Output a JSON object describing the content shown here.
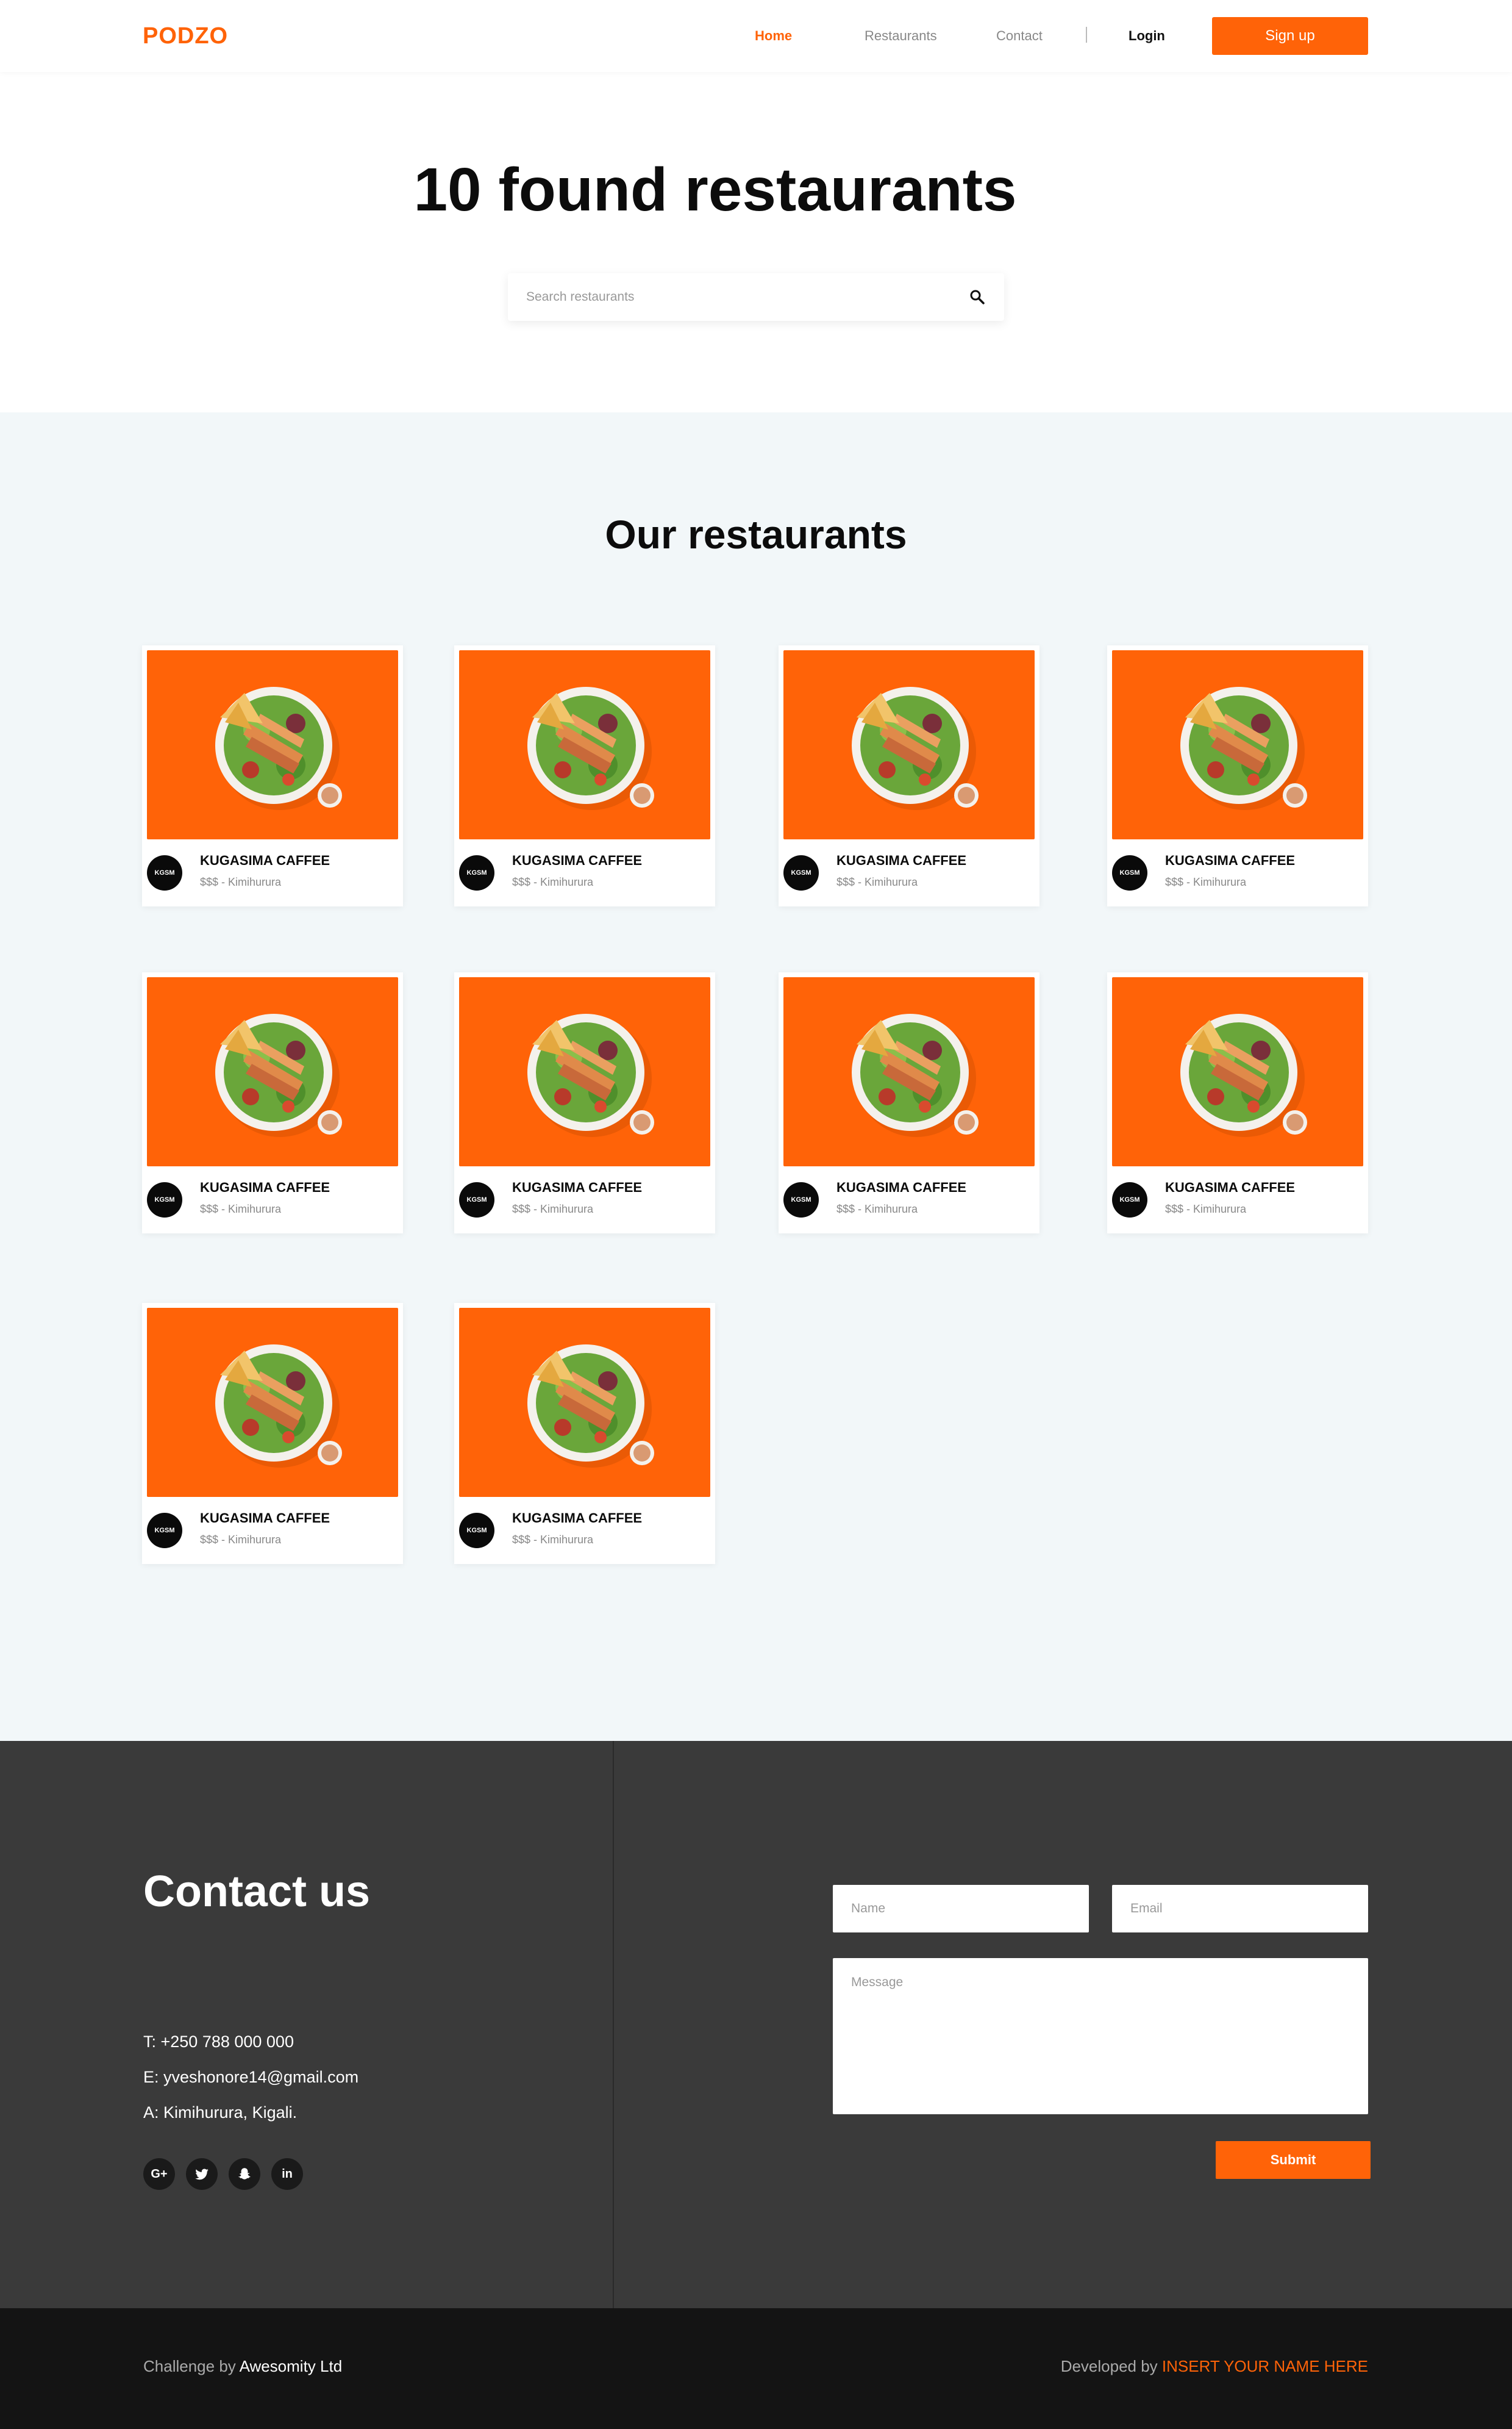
{
  "nav": {
    "logo": "PODZO",
    "links": [
      "Home",
      "Restaurants",
      "Contact"
    ],
    "login": "Login",
    "signup": "Sign up"
  },
  "hero": {
    "title": "10 found restaurants",
    "search_placeholder": "Search restaurants"
  },
  "restaurants": {
    "title": "Our restaurants",
    "cards": [
      {
        "badge": "KGSM",
        "name": "KUGASIMA CAFFEE",
        "meta": "$$$ - Kimihurura"
      },
      {
        "badge": "KGSM",
        "name": "KUGASIMA CAFFEE",
        "meta": "$$$ - Kimihurura"
      },
      {
        "badge": "KGSM",
        "name": "KUGASIMA CAFFEE",
        "meta": "$$$ - Kimihurura"
      },
      {
        "badge": "KGSM",
        "name": "KUGASIMA CAFFEE",
        "meta": "$$$ - Kimihurura"
      },
      {
        "badge": "KGSM",
        "name": "KUGASIMA CAFFEE",
        "meta": "$$$ - Kimihurura"
      },
      {
        "badge": "KGSM",
        "name": "KUGASIMA CAFFEE",
        "meta": "$$$ - Kimihurura"
      },
      {
        "badge": "KGSM",
        "name": "KUGASIMA CAFFEE",
        "meta": "$$$ - Kimihurura"
      },
      {
        "badge": "KGSM",
        "name": "KUGASIMA CAFFEE",
        "meta": "$$$ - Kimihurura"
      },
      {
        "badge": "KGSM",
        "name": "KUGASIMA CAFFEE",
        "meta": "$$$ - Kimihurura"
      },
      {
        "badge": "KGSM",
        "name": "KUGASIMA CAFFEE",
        "meta": "$$$ - Kimihurura"
      }
    ]
  },
  "contact": {
    "title": "Contact us",
    "phone": "T: +250 788 000 000",
    "email": "E: yveshonore14@gmail.com",
    "address": "A: Kimihurura, Kigali.",
    "social": [
      "google-plus-icon",
      "twitter-icon",
      "snapchat-icon",
      "linkedin-icon"
    ],
    "form": {
      "name_placeholder": "Name",
      "email_placeholder": "Email",
      "message_placeholder": "Message",
      "submit": "Submit"
    }
  },
  "footer": {
    "left_prefix": "Challenge by",
    "left_company": "Awesomity Ltd",
    "right_prefix": "Developed by",
    "right_name": "INSERT YOUR NAME HERE"
  },
  "colors": {
    "accent": "#ff6308",
    "section_bg": "#f2f7f9",
    "contact_bg": "#3a3a3a",
    "footer_bg": "#141414"
  }
}
